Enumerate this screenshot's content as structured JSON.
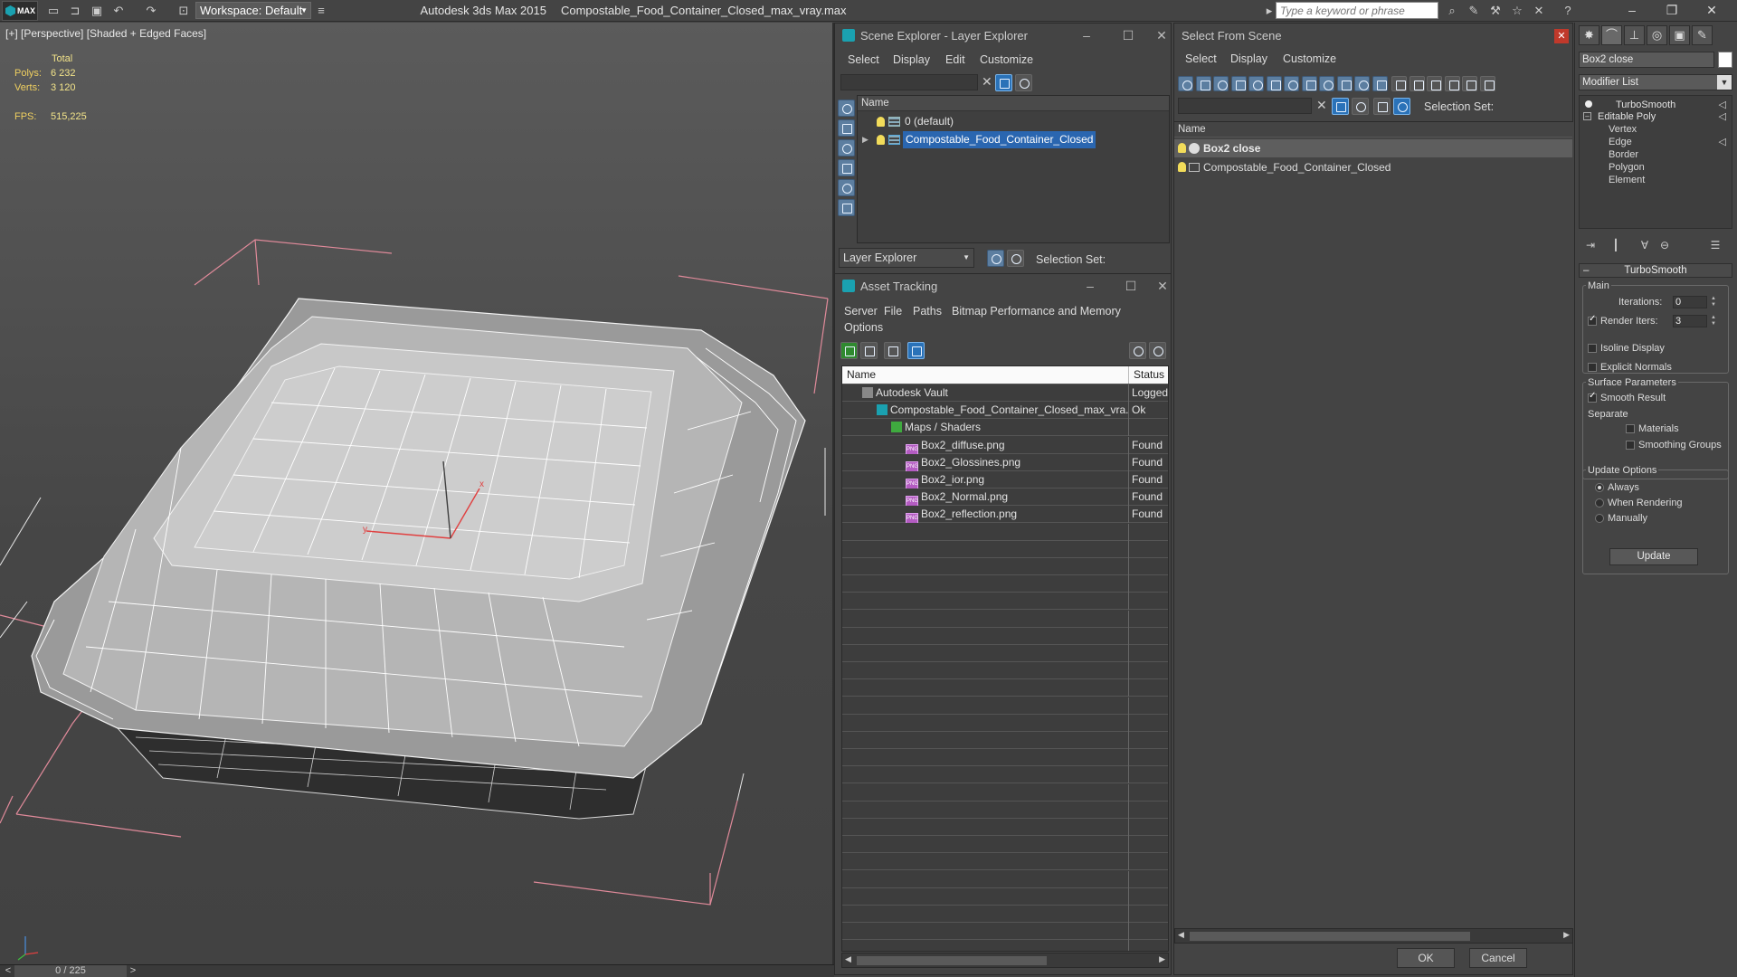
{
  "titlebar": {
    "app": "MAX",
    "workspace": "Workspace: Default",
    "product": "Autodesk 3ds Max  2015",
    "filename": "Compostable_Food_Container_Closed_max_vray.max",
    "search_placeholder": "Type a keyword or phrase"
  },
  "viewport": {
    "label": "[+] [Perspective] [Shaded + Edged Faces]",
    "stats": {
      "total_label": "Total",
      "polys_label": "Polys:",
      "polys": "6 232",
      "verts_label": "Verts:",
      "verts": "3 120",
      "fps_label": "FPS:",
      "fps": "515,225"
    },
    "gizmo": {
      "x": "x",
      "y": "y"
    }
  },
  "timeline": {
    "position": "0 / 225",
    "prev": "<",
    "next": ">"
  },
  "scene_explorer": {
    "title": "Scene Explorer - Layer Explorer",
    "menu": [
      "Select",
      "Display",
      "Edit",
      "Customize"
    ],
    "column": "Name",
    "layers": [
      {
        "name": "0 (default)",
        "selected": false
      },
      {
        "name": "Compostable_Food_Container_Closed",
        "selected": true
      }
    ],
    "footer_dropdown": "Layer Explorer",
    "selection_set_label": "Selection Set:"
  },
  "asset_tracking": {
    "title": "Asset Tracking",
    "menu": [
      "Server",
      "File",
      "Paths",
      "Bitmap Performance and Memory",
      "Options"
    ],
    "columns": {
      "name": "Name",
      "status": "Status"
    },
    "rows": [
      {
        "name": "Autodesk Vault",
        "status": "Logged",
        "indent": 0,
        "icon": "vault-icon"
      },
      {
        "name": "Compostable_Food_Container_Closed_max_vra...",
        "status": "Ok",
        "indent": 1,
        "icon": "max-file-icon"
      },
      {
        "name": "Maps / Shaders",
        "status": "",
        "indent": 2,
        "icon": "maps-icon"
      },
      {
        "name": "Box2_diffuse.png",
        "status": "Found",
        "indent": 3,
        "icon": "png-icon"
      },
      {
        "name": "Box2_Glossines.png",
        "status": "Found",
        "indent": 3,
        "icon": "png-icon"
      },
      {
        "name": "Box2_ior.png",
        "status": "Found",
        "indent": 3,
        "icon": "png-icon"
      },
      {
        "name": "Box2_Normal.png",
        "status": "Found",
        "indent": 3,
        "icon": "png-icon"
      },
      {
        "name": "Box2_reflection.png",
        "status": "Found",
        "indent": 3,
        "icon": "png-icon"
      }
    ],
    "png_badge": "PNG"
  },
  "select_from_scene": {
    "title": "Select From Scene",
    "menu": [
      "Select",
      "Display",
      "Customize"
    ],
    "selection_set_label": "Selection Set:",
    "column": "Name",
    "objects": [
      {
        "name": "Box2 close",
        "selected": true
      },
      {
        "name": "Compostable_Food_Container_Closed",
        "selected": false
      }
    ],
    "ok": "OK",
    "cancel": "Cancel"
  },
  "command_panel": {
    "object_name": "Box2 close",
    "modifier_list": "Modifier List",
    "stack": [
      "TurboSmooth",
      "Editable Poly",
      "Vertex",
      "Edge",
      "Border",
      "Polygon",
      "Element"
    ],
    "rollout_title": "TurboSmooth",
    "main_group": "Main",
    "iterations_label": "Iterations:",
    "iterations": "0",
    "render_iters_label": "Render Iters:",
    "render_iters": "3",
    "isoline_display": "Isoline Display",
    "explicit_normals": "Explicit Normals",
    "surface_group": "Surface Parameters",
    "smooth_result": "Smooth Result",
    "separate_label": "Separate",
    "materials": "Materials",
    "smoothing_groups": "Smoothing Groups",
    "update_group": "Update Options",
    "always": "Always",
    "when_rendering": "When Rendering",
    "manually": "Manually",
    "update_button": "Update"
  }
}
